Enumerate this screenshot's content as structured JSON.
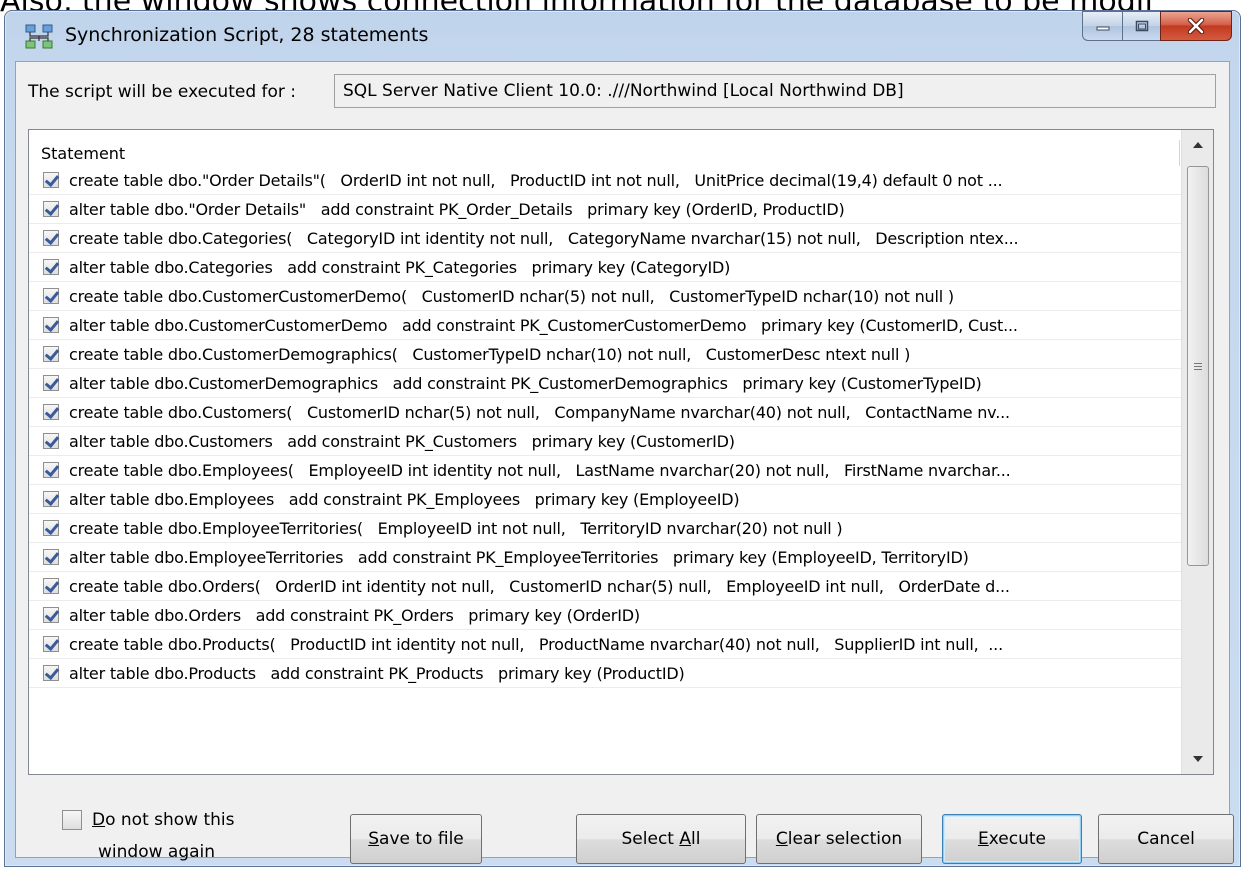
{
  "background": {
    "text": "Also, the window shows connection information for the database to be modif"
  },
  "window": {
    "title": "Synchronization Script, 28 statements"
  },
  "exec": {
    "label": "The script will be executed for :",
    "value": "SQL Server Native Client 10.0: .///Northwind [Local Northwind DB]"
  },
  "list": {
    "header": "Statement",
    "rows": [
      {
        "checked": true,
        "text": "create table dbo.\"Order Details\"(   OrderID int not null,   ProductID int not null,   UnitPrice decimal(19,4) default 0 not ..."
      },
      {
        "checked": true,
        "text": "alter table dbo.\"Order Details\"   add constraint PK_Order_Details   primary key (OrderID, ProductID)"
      },
      {
        "checked": true,
        "text": "create table dbo.Categories(   CategoryID int identity not null,   CategoryName nvarchar(15) not null,   Description ntex..."
      },
      {
        "checked": true,
        "text": "alter table dbo.Categories   add constraint PK_Categories   primary key (CategoryID)"
      },
      {
        "checked": true,
        "text": "create table dbo.CustomerCustomerDemo(   CustomerID nchar(5) not null,   CustomerTypeID nchar(10) not null )"
      },
      {
        "checked": true,
        "text": "alter table dbo.CustomerCustomerDemo   add constraint PK_CustomerCustomerDemo   primary key (CustomerID, Cust..."
      },
      {
        "checked": true,
        "text": "create table dbo.CustomerDemographics(   CustomerTypeID nchar(10) not null,   CustomerDesc ntext null )"
      },
      {
        "checked": true,
        "text": "alter table dbo.CustomerDemographics   add constraint PK_CustomerDemographics   primary key (CustomerTypeID)"
      },
      {
        "checked": true,
        "text": "create table dbo.Customers(   CustomerID nchar(5) not null,   CompanyName nvarchar(40) not null,   ContactName nv..."
      },
      {
        "checked": true,
        "text": "alter table dbo.Customers   add constraint PK_Customers   primary key (CustomerID)"
      },
      {
        "checked": true,
        "text": "create table dbo.Employees(   EmployeeID int identity not null,   LastName nvarchar(20) not null,   FirstName nvarchar..."
      },
      {
        "checked": true,
        "text": "alter table dbo.Employees   add constraint PK_Employees   primary key (EmployeeID)"
      },
      {
        "checked": true,
        "text": "create table dbo.EmployeeTerritories(   EmployeeID int not null,   TerritoryID nvarchar(20) not null )"
      },
      {
        "checked": true,
        "text": "alter table dbo.EmployeeTerritories   add constraint PK_EmployeeTerritories   primary key (EmployeeID, TerritoryID)"
      },
      {
        "checked": true,
        "text": "create table dbo.Orders(   OrderID int identity not null,   CustomerID nchar(5) null,   EmployeeID int null,   OrderDate d..."
      },
      {
        "checked": true,
        "text": "alter table dbo.Orders   add constraint PK_Orders   primary key (OrderID)"
      },
      {
        "checked": true,
        "text": "create table dbo.Products(   ProductID int identity not null,   ProductName nvarchar(40) not null,   SupplierID int null,  ..."
      },
      {
        "checked": true,
        "text": "alter table dbo.Products   add constraint PK_Products   primary key (ProductID)"
      }
    ]
  },
  "footer": {
    "do_not_show_u": "D",
    "do_not_show_line1": "o not show this",
    "do_not_show_line2": "window again",
    "do_not_show_checked": false,
    "save_u": "S",
    "save_rest": "ave to file",
    "select_all_pre": "Select ",
    "select_all_u": "A",
    "select_all_post": "ll",
    "clear_u": "C",
    "clear_rest": "lear selection",
    "execute_u": "E",
    "execute_rest": "xecute",
    "cancel": "Cancel"
  },
  "icons": {
    "app": "database-sync-icon",
    "minimize": "minimize-icon",
    "maximize": "maximize-icon",
    "close": "close-icon",
    "scroll_up": "scroll-up-arrow-icon",
    "scroll_down": "scroll-down-arrow-icon"
  },
  "colors": {
    "close_button": "#c23a20",
    "title_bar": "#bfd3ea",
    "default_button_border": "#3c7fb1",
    "checkmark": "#3a5a9a"
  }
}
